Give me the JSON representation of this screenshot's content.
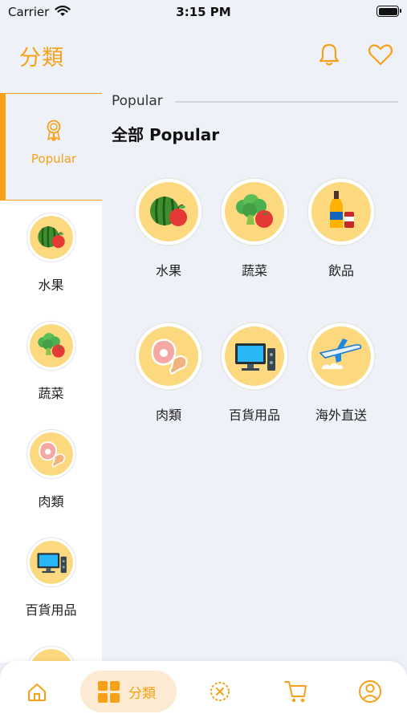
{
  "status": {
    "carrier": "Carrier",
    "time": "3:15 PM"
  },
  "header": {
    "title": "分類"
  },
  "sidebar": {
    "active": {
      "label": "Popular"
    },
    "items": [
      {
        "label": "水果",
        "icon": "fruit-icon"
      },
      {
        "label": "蔬菜",
        "icon": "vegetable-icon"
      },
      {
        "label": "肉類",
        "icon": "meat-icon"
      },
      {
        "label": "百貨用品",
        "icon": "computer-icon"
      }
    ]
  },
  "section": {
    "title": "Popular",
    "subtitle": "全部 Popular"
  },
  "grid": [
    {
      "label": "水果",
      "icon": "fruit-icon"
    },
    {
      "label": "蔬菜",
      "icon": "vegetable-icon"
    },
    {
      "label": "飲品",
      "icon": "drinks-icon"
    },
    {
      "label": "肉類",
      "icon": "meat-icon"
    },
    {
      "label": "百貨用品",
      "icon": "computer-icon"
    },
    {
      "label": "海外直送",
      "icon": "airplane-icon"
    }
  ],
  "tabbar": {
    "active_label": "分類",
    "tabs": [
      "home-icon",
      "category-icon",
      "coupon-icon",
      "cart-icon",
      "profile-icon"
    ]
  },
  "colors": {
    "accent": "#F7A11A",
    "circle": "#FCD97F",
    "background": "#EFF1F8"
  }
}
